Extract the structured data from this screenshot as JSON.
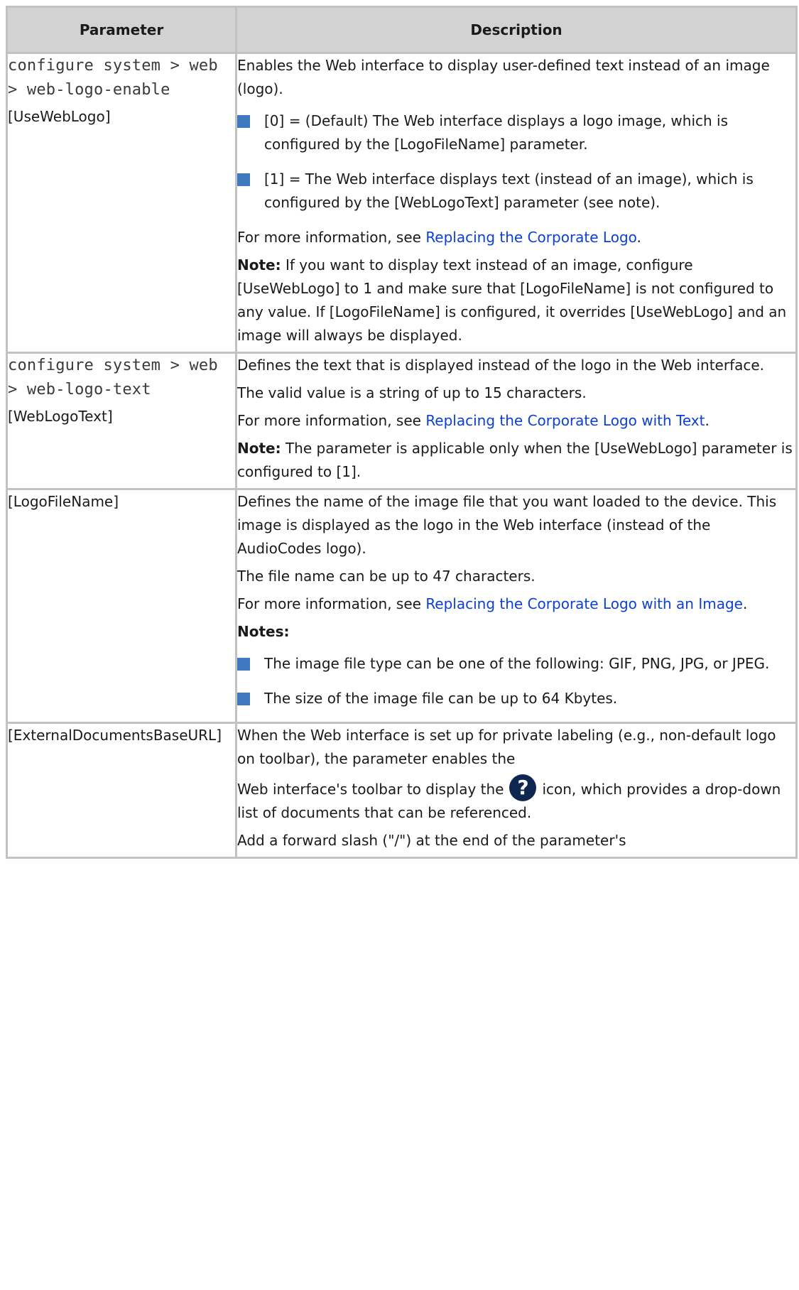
{
  "header": {
    "parameter": "Parameter",
    "description": "Description"
  },
  "rows": [
    {
      "cli": "configure system > web > web-logo-enable",
      "ini": "[UseWebLogo]",
      "intro": "Enables the Web interface to display user-defined text instead of an image (logo).",
      "bullets": [
        "[0] = (Default) The Web interface displays a logo image, which is configured by the [LogoFileName] parameter.",
        "[1] = The Web interface displays text (instead of an image), which is configured by the [WebLogoText] parameter (see note)."
      ],
      "more_prefix": "For more information, see ",
      "more_link": "Replacing the Corporate Logo",
      "more_suffix": ".",
      "note_label": "Note:",
      "note_text": " If you want to display text instead of an image, configure [UseWebLogo] to 1 and make sure that [LogoFileName] is not configured to any value. If [LogoFileName] is configured, it overrides [UseWebLogo] and an image will always be displayed."
    },
    {
      "cli": "configure system > web > web-logo-text",
      "ini": "[WebLogoText]",
      "intro": "Defines the text that is displayed instead of the logo in the Web interface.",
      "valid": "The valid value is a string of up to 15 characters.",
      "more_prefix": "For more information, see ",
      "more_link": "Replacing the Corporate Logo with Text",
      "more_suffix": ".",
      "note_label": "Note:",
      "note_text": " The parameter is applicable only when the [UseWebLogo] parameter is configured to [1]."
    },
    {
      "ini": "[LogoFileName]",
      "intro": "Defines the name of the image file that you want loaded to the device. This image is displayed as the logo in the Web interface (instead of the AudioCodes logo).",
      "valid": "The file name can be up to 47 characters.",
      "more_prefix": "For more information, see ",
      "more_link": "Replacing the Corporate Logo with an Image",
      "more_suffix": ".",
      "notes_label": "Notes:",
      "bullets": [
        "The image file type can be one of the following: GIF, PNG, JPG, or JPEG.",
        "The size of the image file can be up to 64 Kbytes."
      ]
    },
    {
      "ini": "[ExternalDocumentsBaseURL]",
      "intro": "When the Web interface is set up for private labeling (e.g., non-default logo on toolbar), the parameter enables the",
      "icon_prefix": "Web interface's toolbar to display the",
      "icon_glyph": "?",
      "icon_suffix": "icon, which provides a drop-down list of documents that can be referenced.",
      "last": "Add a forward slash (\"/\") at the end of the parameter's"
    }
  ]
}
